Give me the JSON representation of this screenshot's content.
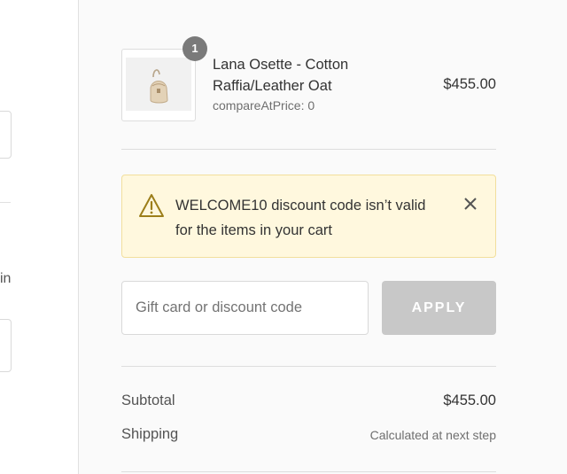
{
  "left": {
    "partial_text": "in"
  },
  "cart": {
    "item": {
      "name": "Lana Osette - Cotton Raffia/Leather Oat",
      "meta": "compareAtPrice: 0",
      "price": "$455.00",
      "quantity": "1",
      "image_icon": "bag-product-image"
    }
  },
  "alert": {
    "icon": "warning-triangle-icon",
    "message": "WELCOME10 discount code isn’t valid for the items in your cart",
    "close_icon": "close-icon",
    "background": "#fff8de",
    "border": "#f2df9d"
  },
  "discount": {
    "placeholder": "Gift card or discount code",
    "value": "",
    "apply_label": "APPLY",
    "apply_color": "#c8c8c8"
  },
  "summary": {
    "subtotal_label": "Subtotal",
    "subtotal_value": "$455.00",
    "shipping_label": "Shipping",
    "shipping_value": "Calculated at next step"
  }
}
